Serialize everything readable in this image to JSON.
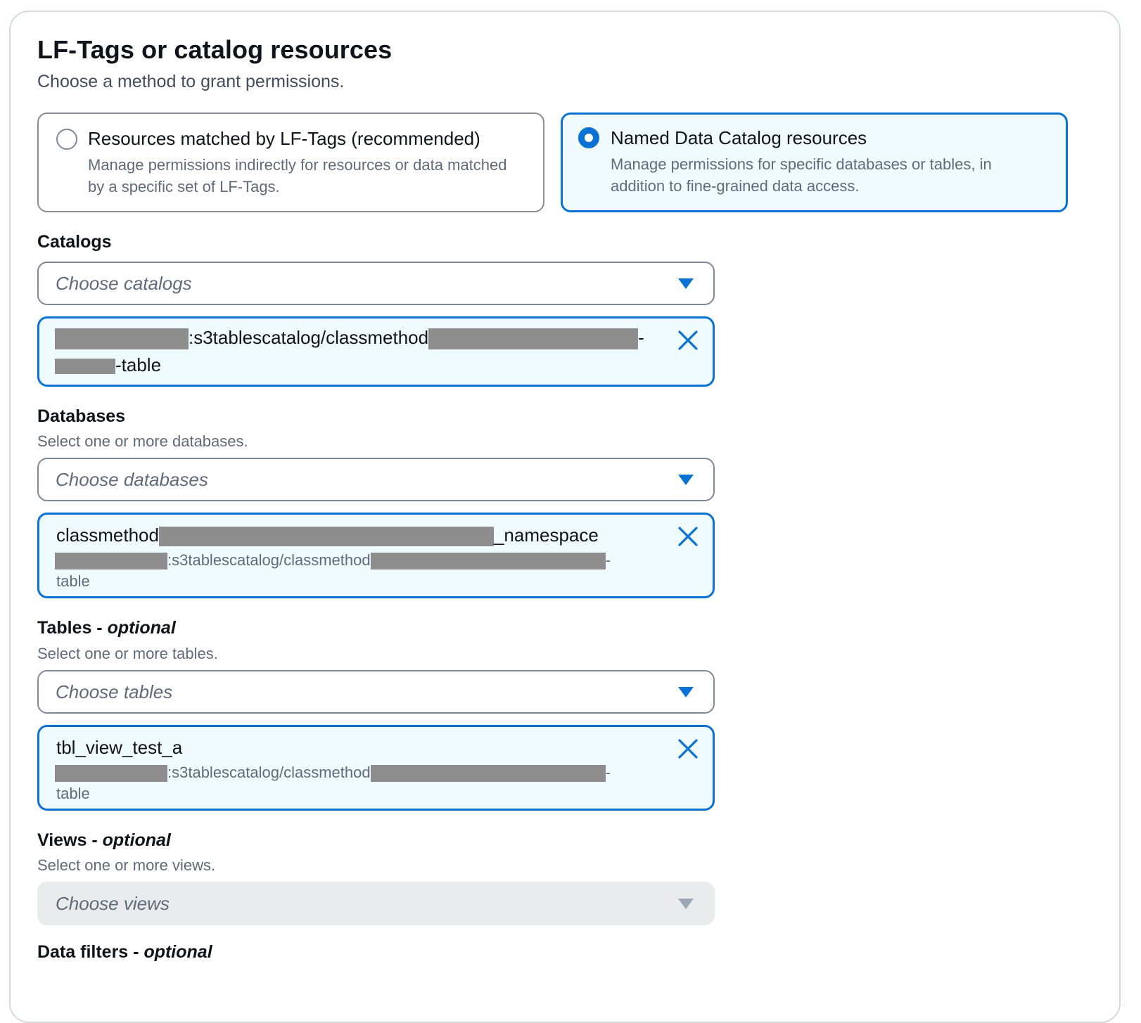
{
  "section": {
    "title": "LF-Tags or catalog resources",
    "description": "Choose a method to grant permissions."
  },
  "methods": [
    {
      "title": "Resources matched by LF-Tags (recommended)",
      "description": "Manage permissions indirectly for resources or data matched by a specific set of LF-Tags.",
      "selected": false
    },
    {
      "title": "Named Data Catalog resources",
      "description": "Manage permissions for specific databases or tables, in addition to fine-grained data access.",
      "selected": true
    }
  ],
  "catalogs": {
    "label": "Catalogs",
    "placeholder": "Choose catalogs",
    "token": {
      "line1_mid": ":s3tablescatalog/classmethod",
      "line1_end": "-",
      "line2_end": "-table"
    }
  },
  "databases": {
    "label": "Databases",
    "description": "Select one or more databases.",
    "placeholder": "Choose databases",
    "token": {
      "name_start": "classmethod",
      "name_end": "_namespace",
      "sub_mid": ":s3tablescatalog/classmethod",
      "sub_end": "-",
      "sub_line2": "table"
    }
  },
  "tables": {
    "label": "Tables - ",
    "label_optional": "optional",
    "description": "Select one or more tables.",
    "placeholder": "Choose tables",
    "token": {
      "name": "tbl_view_test_a",
      "sub_mid": ":s3tablescatalog/classmethod",
      "sub_end": "-",
      "sub_line2": "table"
    }
  },
  "views": {
    "label": "Views - ",
    "label_optional": "optional",
    "description": "Select one or more views.",
    "placeholder": "Choose views",
    "disabled": true
  },
  "data_filters": {
    "label": "Data filters - ",
    "label_optional": "optional"
  },
  "colors": {
    "accent": "#0972d3",
    "selected_bg": "#f0fbff",
    "redaction": "#8e8e8e"
  },
  "icons": {
    "radio": "radio-icon",
    "caret": "caret-down-icon",
    "dismiss": "close-icon"
  }
}
